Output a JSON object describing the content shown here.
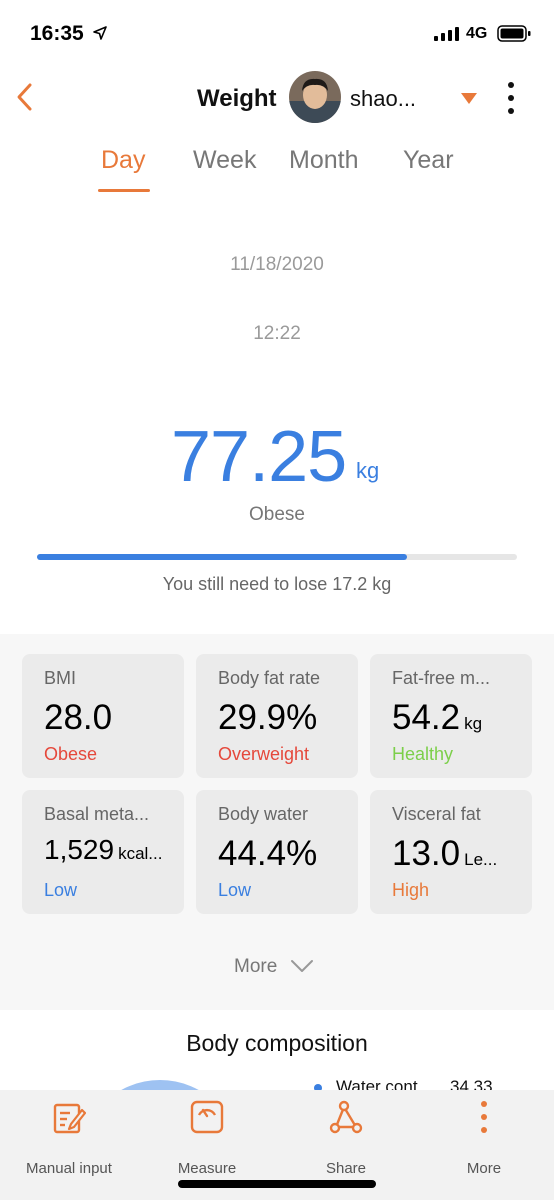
{
  "status_bar": {
    "time": "16:35",
    "network": "4G"
  },
  "nav": {
    "title": "Weight",
    "user_name": "shao..."
  },
  "tabs": [
    {
      "label": "Day",
      "active": true
    },
    {
      "label": "Week",
      "active": false
    },
    {
      "label": "Month",
      "active": false
    },
    {
      "label": "Year",
      "active": false
    }
  ],
  "reading": {
    "date": "11/18/2020",
    "time": "12:22",
    "weight": "77.25",
    "unit": "kg",
    "status": "Obese",
    "goal_progress": 0.77,
    "hint": "You still need to lose 17.2 kg"
  },
  "metrics": [
    {
      "label": "BMI",
      "value": "28.0",
      "unit": "",
      "status": "Obese",
      "status_color": "#e5483b"
    },
    {
      "label": "Body fat rate",
      "value": "29.9%",
      "unit": "",
      "status": "Overweight",
      "status_color": "#e5483b"
    },
    {
      "label": "Fat-free m...",
      "value": "54.2",
      "unit": "kg",
      "status": "Healthy",
      "status_color": "#7ccf4a"
    },
    {
      "label": "Basal meta...",
      "value": "1,529",
      "unit": "kcal...",
      "status": "Low",
      "status_color": "#3a7fe0"
    },
    {
      "label": "Body water",
      "value": "44.4%",
      "unit": "",
      "status": "Low",
      "status_color": "#3a7fe0"
    },
    {
      "label": "Visceral fat",
      "value": "13.0",
      "unit": "Le...",
      "status": "High",
      "status_color": "#e8793a"
    }
  ],
  "more": {
    "label": "More"
  },
  "composition": {
    "title": "Body composition",
    "legend_label": "Water cont...",
    "legend_value": "34.33"
  },
  "bottom_nav": [
    {
      "label": "Manual input",
      "icon": "edit-icon"
    },
    {
      "label": "Measure",
      "icon": "scale-icon"
    },
    {
      "label": "Share",
      "icon": "share-icon"
    },
    {
      "label": "More",
      "icon": "more-vertical-icon"
    }
  ],
  "colors": {
    "accent": "#e8793a",
    "primary": "#3a7fe0"
  }
}
